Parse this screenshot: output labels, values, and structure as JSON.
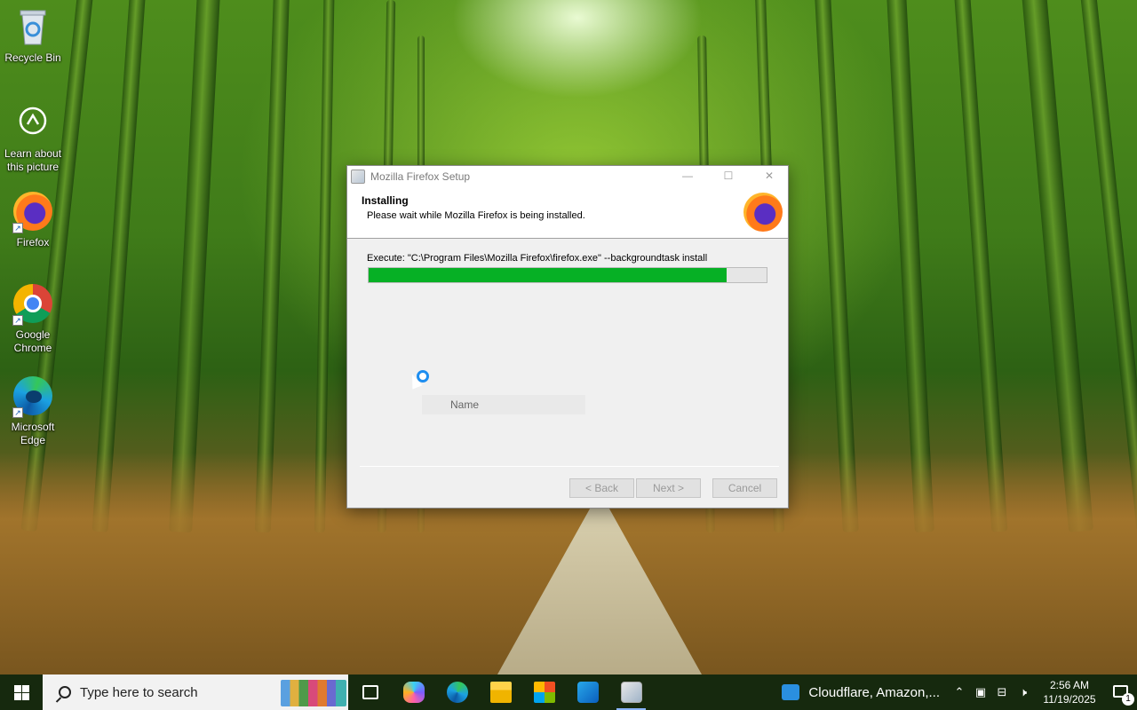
{
  "desktop": {
    "icons": [
      {
        "label": "Recycle Bin",
        "icon": "recycle-bin-icon"
      },
      {
        "label": "Learn about this picture",
        "icon": "camera-info-icon"
      },
      {
        "label": "Firefox",
        "icon": "firefox-icon"
      },
      {
        "label": "Google Chrome",
        "icon": "chrome-icon"
      },
      {
        "label": "Microsoft Edge",
        "icon": "edge-icon"
      }
    ]
  },
  "dialog": {
    "title": "Mozilla Firefox Setup",
    "header_title": "Installing",
    "header_subtitle": "Please wait while Mozilla Firefox is being installed.",
    "exec_text": "Execute: \"C:\\Program Files\\Mozilla Firefox\\firefox.exe\" --backgroundtask install",
    "progress": 0.9,
    "list_column": "Name",
    "buttons": {
      "back": "< Back",
      "next": "Next >",
      "cancel": "Cancel"
    },
    "colors": {
      "progress": "#06b025"
    }
  },
  "taskbar": {
    "search_placeholder": "Type here to search",
    "pinned": [
      "task-view-icon",
      "copilot-icon",
      "edge-icon",
      "file-explorer-icon",
      "store-icon",
      "outlook-icon",
      "setup-icon"
    ],
    "news": "Cloudflare, Amazon,...",
    "time": "2:56 AM",
    "date": "11/19/2025",
    "notification_count": "1"
  }
}
